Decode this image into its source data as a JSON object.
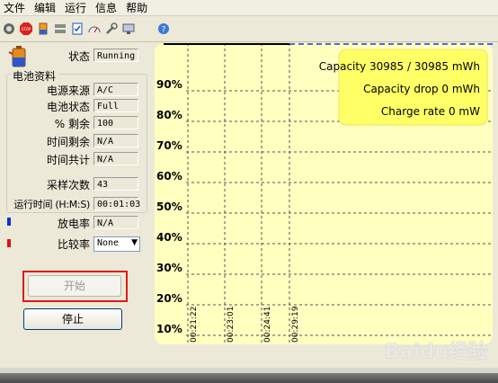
{
  "menu": [
    "文件",
    "编辑",
    "运行",
    "信息",
    "帮助"
  ],
  "toolbar_icons": [
    "gear-icon",
    "stop-icon",
    "battery-icon",
    "drives-icon",
    "checklist-icon",
    "gauge-icon",
    "wrench-icon",
    "screen-icon",
    "help-icon"
  ],
  "status": {
    "label": "状态",
    "value": "Running"
  },
  "battery_info": {
    "title": "电池资料",
    "rows": [
      {
        "label": "电源来源",
        "value": "A/C"
      },
      {
        "label": "电池状态",
        "value": "Full"
      },
      {
        "label": "% 剩余",
        "value": "100"
      },
      {
        "label": "时间剩余",
        "value": "N/A"
      },
      {
        "label": "时间共计",
        "value": "N/A"
      }
    ]
  },
  "samples": {
    "label": "采样次数",
    "value": "43"
  },
  "runtime": {
    "label": "运行时间 (H:M:S)",
    "value": "00:01:03"
  },
  "discharge": {
    "label": "放电率",
    "value": "N/A",
    "marker_color": "#1030e0"
  },
  "compare": {
    "label": "比较率",
    "selected": "None",
    "marker_color": "#e01010"
  },
  "buttons": {
    "start": "开始",
    "stop": "停止"
  },
  "highlight_color": "#e01818",
  "chart_data": {
    "type": "line",
    "y_tick_labels": [
      "90%",
      "80%",
      "70%",
      "60%",
      "50%",
      "40%",
      "30%",
      "20%",
      "10%"
    ],
    "x_tick_labels": [
      "00:21:22",
      "00:23:01",
      "00:24:41",
      "00:29:19"
    ],
    "info_lines": [
      "Capacity 30985 / 30985 mWh",
      "Capacity drop 0 mWh",
      "Charge rate 0 mW"
    ],
    "series": [
      {
        "color": "#000000",
        "style": "solid",
        "x": [
          "00:21:22",
          "00:29:19"
        ],
        "y": [
          100,
          100
        ]
      },
      {
        "color": "#1a3cd8",
        "style": "dashed",
        "x": [
          "00:29:19",
          "end"
        ],
        "y": [
          100,
          100
        ]
      }
    ],
    "background": "#ffffc0",
    "info_box_color": "#ffff66"
  },
  "watermark": "Baidu 经验"
}
